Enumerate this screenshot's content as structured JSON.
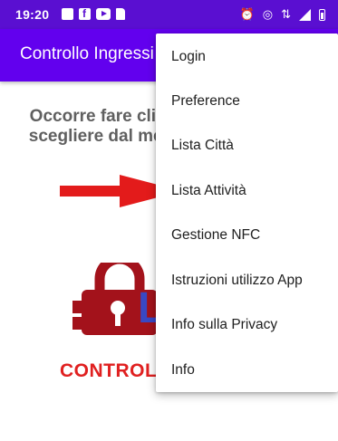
{
  "status_bar": {
    "time": "19:20",
    "left_icons": [
      "image-icon",
      "facebook-icon",
      "youtube-icon",
      "sd-card-icon"
    ],
    "right_icons": [
      "alarm-icon",
      "hotspot-icon",
      "data-icon",
      "signal-icon",
      "battery-icon"
    ],
    "alarm_glyph": "⏰",
    "hotspot_glyph": "◎",
    "data_glyph": "⇅"
  },
  "app_bar": {
    "title": "Controllo Ingressi"
  },
  "main": {
    "instruction": "Occorre fare click sull'immagine o scegliere dal menù in alto a destra",
    "logo_letter": "L",
    "logo_text": "CONTROLLO INGRESSI"
  },
  "menu": {
    "items": [
      {
        "label": "Login"
      },
      {
        "label": "Preference"
      },
      {
        "label": "Lista Città"
      },
      {
        "label": "Lista Attività"
      },
      {
        "label": "Gestione NFC"
      },
      {
        "label": "Istruzioni utilizzo App"
      },
      {
        "label": "Info sulla Privacy"
      },
      {
        "label": "Info"
      }
    ]
  },
  "colors": {
    "status_bar": "#5a0fd1",
    "app_bar": "#6200ee",
    "logo_red": "#a3121b",
    "logo_blue": "#3948c4",
    "arrow_red": "#e31b1b"
  }
}
